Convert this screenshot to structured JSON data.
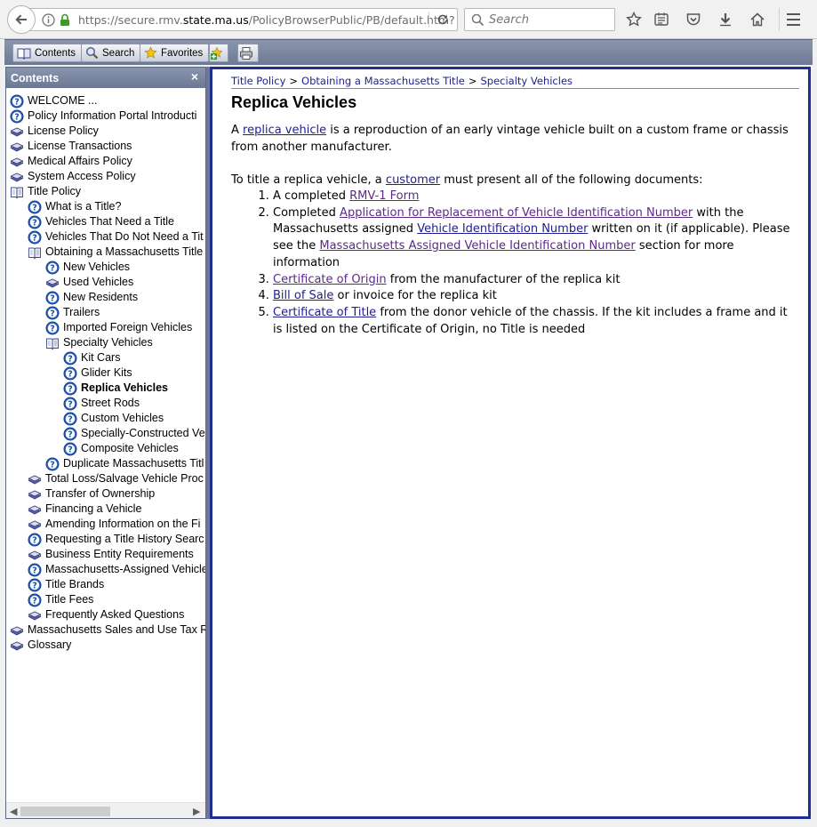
{
  "browser": {
    "url_prefix": "https://secure.rmv.",
    "url_domain": "state.ma.us",
    "url_path": "/PolicyBrowserPublic/PB/default.htm?",
    "search_placeholder": "Search"
  },
  "toolbar": {
    "contents_label": "Contents",
    "search_label": "Search",
    "favorites_label": "Favorites"
  },
  "left_pane": {
    "title": "Contents",
    "close_glyph": "×",
    "tree": [
      {
        "label": "WELCOME ...",
        "icon": "help-page",
        "indent": 0
      },
      {
        "label": "Policy Information Portal Introducti",
        "icon": "help-page",
        "indent": 0
      },
      {
        "label": "License Policy",
        "icon": "closed-book",
        "indent": 0
      },
      {
        "label": "License Transactions",
        "icon": "closed-book",
        "indent": 0
      },
      {
        "label": "Medical Affairs Policy",
        "icon": "closed-book",
        "indent": 0
      },
      {
        "label": "System Access Policy",
        "icon": "closed-book",
        "indent": 0
      },
      {
        "label": "Title Policy",
        "icon": "open-book",
        "indent": 0
      },
      {
        "label": "What is a Title?",
        "icon": "help-page",
        "indent": 1
      },
      {
        "label": "Vehicles That Need a Title",
        "icon": "help-page",
        "indent": 1
      },
      {
        "label": "Vehicles That Do Not Need a Tit",
        "icon": "help-page",
        "indent": 1
      },
      {
        "label": "Obtaining a Massachusetts Title",
        "icon": "open-book",
        "indent": 1
      },
      {
        "label": "New Vehicles",
        "icon": "help-page",
        "indent": 2
      },
      {
        "label": "Used Vehicles",
        "icon": "closed-book",
        "indent": 2
      },
      {
        "label": "New Residents",
        "icon": "help-page",
        "indent": 2
      },
      {
        "label": "Trailers",
        "icon": "help-page",
        "indent": 2
      },
      {
        "label": "Imported Foreign Vehicles",
        "icon": "help-page",
        "indent": 2
      },
      {
        "label": "Specialty Vehicles",
        "icon": "open-book",
        "indent": 2
      },
      {
        "label": "Kit Cars",
        "icon": "help-page",
        "indent": 3
      },
      {
        "label": "Glider Kits",
        "icon": "help-page",
        "indent": 3
      },
      {
        "label": "Replica Vehicles",
        "icon": "help-page",
        "indent": 3,
        "selected": true
      },
      {
        "label": "Street Rods",
        "icon": "help-page",
        "indent": 3
      },
      {
        "label": "Custom Vehicles",
        "icon": "help-page",
        "indent": 3
      },
      {
        "label": "Specially-Constructed Ve",
        "icon": "help-page",
        "indent": 3
      },
      {
        "label": "Composite Vehicles",
        "icon": "help-page",
        "indent": 3
      },
      {
        "label": "Duplicate Massachusetts Titl",
        "icon": "help-page",
        "indent": 2
      },
      {
        "label": "Total Loss/Salvage Vehicle Proc",
        "icon": "closed-book",
        "indent": 1
      },
      {
        "label": "Transfer of Ownership",
        "icon": "closed-book",
        "indent": 1
      },
      {
        "label": "Financing a Vehicle",
        "icon": "closed-book",
        "indent": 1
      },
      {
        "label": "Amending Information on the Fi",
        "icon": "closed-book",
        "indent": 1
      },
      {
        "label": "Requesting a Title History Searc",
        "icon": "help-page",
        "indent": 1
      },
      {
        "label": "Business Entity Requirements",
        "icon": "closed-book",
        "indent": 1
      },
      {
        "label": "Massachusetts-Assigned Vehicle",
        "icon": "help-page",
        "indent": 1
      },
      {
        "label": "Title Brands",
        "icon": "help-page",
        "indent": 1
      },
      {
        "label": "Title Fees",
        "icon": "help-page",
        "indent": 1
      },
      {
        "label": "Frequently Asked Questions",
        "icon": "closed-book",
        "indent": 1
      },
      {
        "label": "Massachusetts Sales and Use Tax R",
        "icon": "closed-book",
        "indent": 0
      },
      {
        "label": "Glossary",
        "icon": "closed-book",
        "indent": 0
      }
    ]
  },
  "content": {
    "breadcrumb": [
      "Title Policy",
      "Obtaining a Massachusetts Title",
      "Specialty Vehicles"
    ],
    "breadcrumb_sep": ">",
    "title": "Replica Vehicles",
    "intro": {
      "pre": "A ",
      "link": "replica vehicle",
      "post": " is a reproduction of an early vintage vehicle built on a custom frame or chassis from another manufacturer."
    },
    "lead": {
      "pre": "To title a replica vehicle, a ",
      "link": "customer",
      "post": " must present all of the following documents:"
    },
    "items": [
      {
        "parts": [
          {
            "t": "A completed "
          },
          {
            "link": "RMV-1 Form",
            "visited": true
          }
        ]
      },
      {
        "parts": [
          {
            "t": "Completed "
          },
          {
            "link": "Application for Replacement of Vehicle Identification Number",
            "visited": true
          },
          {
            "t": " with the Massachusetts assigned "
          },
          {
            "link": "Vehicle Identification Number",
            "visited": false
          },
          {
            "t": " written on it (if applicable). Please see the "
          },
          {
            "link": "Massachusetts Assigned Vehicle Identification Number",
            "visited": true
          },
          {
            "t": " section for more information"
          }
        ]
      },
      {
        "parts": [
          {
            "link": "Certificate of Origin",
            "visited": true
          },
          {
            "t": " from the manufacturer of the replica kit"
          }
        ]
      },
      {
        "parts": [
          {
            "link": "Bill of Sale",
            "visited": false
          },
          {
            "t": " or invoice for the replica kit"
          }
        ]
      },
      {
        "parts": [
          {
            "link": "Certificate of Title",
            "visited": false
          },
          {
            "t": " from the donor vehicle of the chassis.  If the kit includes a frame and it is listed on the Certificate of Origin, no Title is needed"
          }
        ]
      }
    ]
  },
  "colors": {
    "link": "#1f1d8f",
    "visited_link": "#5b2a86",
    "content_border": "#1e2f8f",
    "pane_header": "#7a85a1"
  }
}
